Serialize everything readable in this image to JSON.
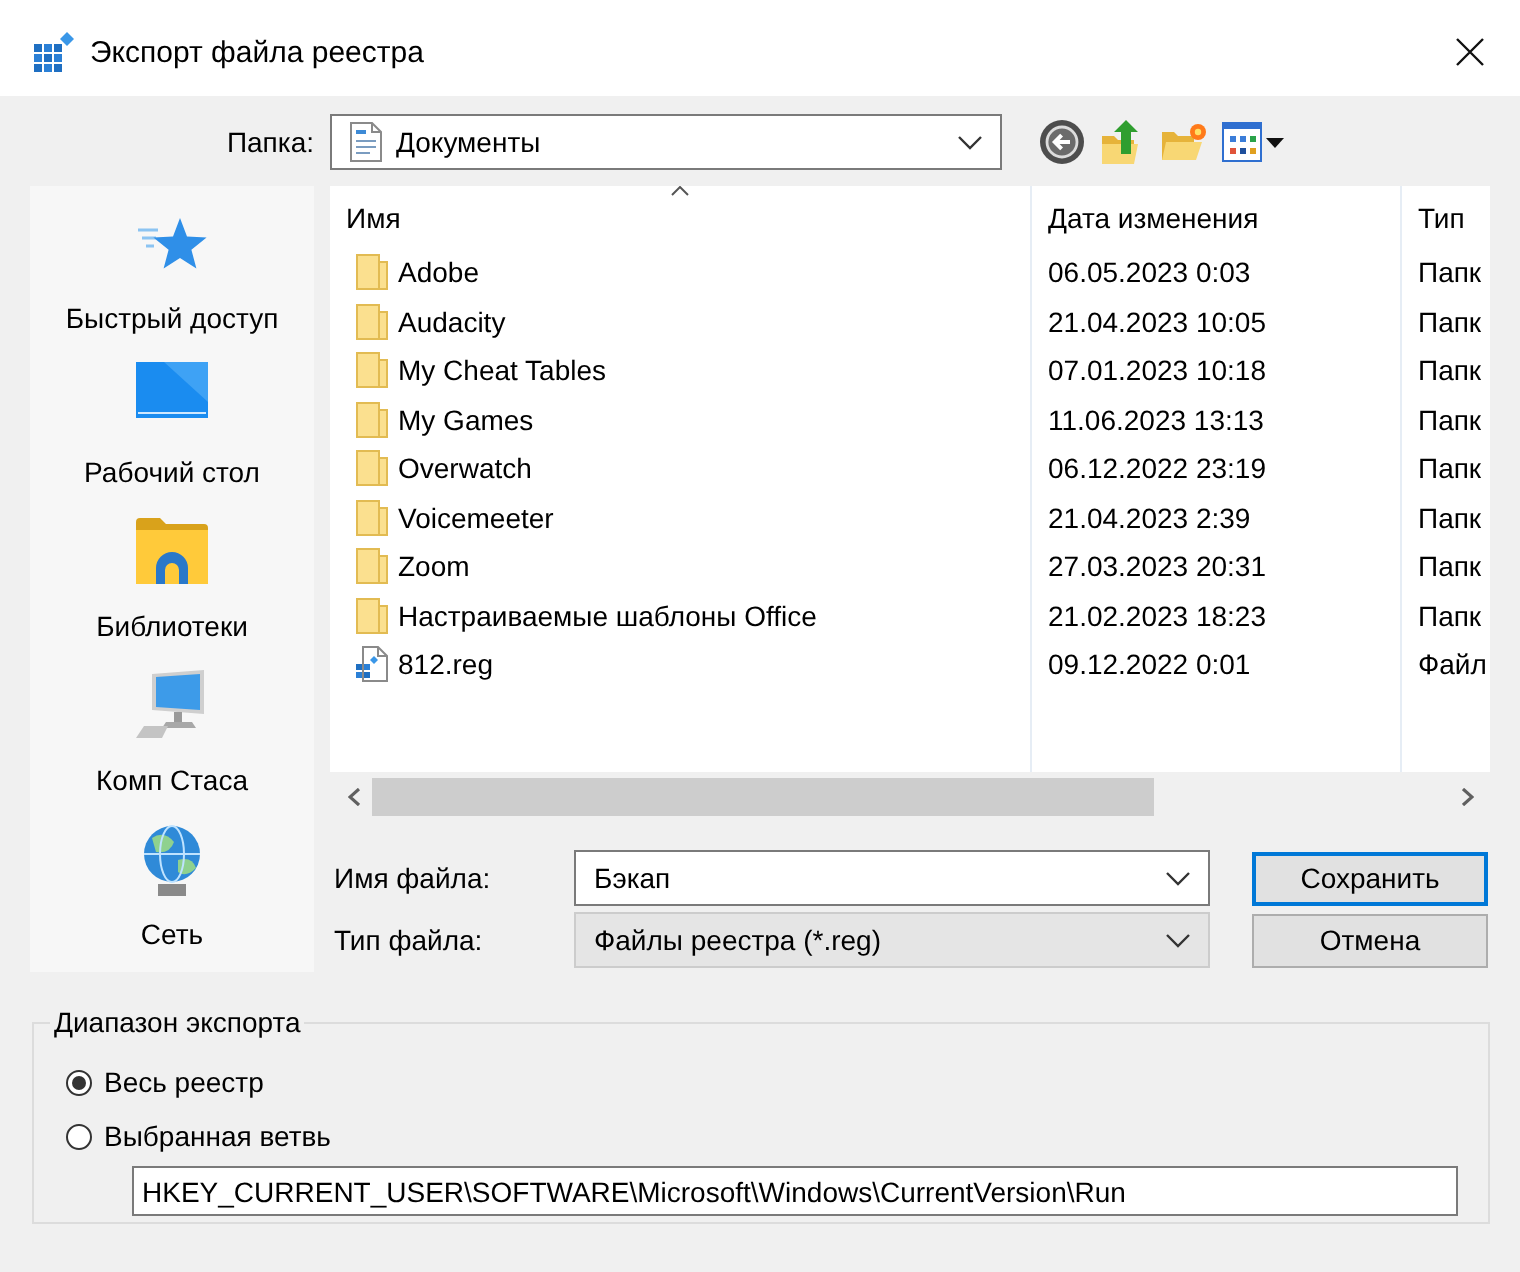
{
  "window": {
    "title": "Экспорт файла реестра"
  },
  "folder": {
    "label": "Папка:",
    "value": "Документы"
  },
  "places": [
    {
      "kind": "quick_access",
      "label": "Быстрый доступ"
    },
    {
      "kind": "desktop",
      "label": "Рабочий стол"
    },
    {
      "kind": "libraries",
      "label": "Библиотеки"
    },
    {
      "kind": "computer",
      "label": "Комп Стаса"
    },
    {
      "kind": "network",
      "label": "Сеть"
    }
  ],
  "file_list": {
    "columns": [
      {
        "label": "Имя",
        "sorted": true
      },
      {
        "label": "Дата изменения",
        "sorted": false
      },
      {
        "label": "Тип",
        "sorted": false
      }
    ],
    "rows": [
      {
        "kind": "folder",
        "name": "Adobe",
        "date": "06.05.2023 0:03",
        "type": "Папк"
      },
      {
        "kind": "folder",
        "name": "Audacity",
        "date": "21.04.2023 10:05",
        "type": "Папк"
      },
      {
        "kind": "folder",
        "name": "My Cheat Tables",
        "date": "07.01.2023 10:18",
        "type": "Папк"
      },
      {
        "kind": "folder",
        "name": "My Games",
        "date": "11.06.2023 13:13",
        "type": "Папк"
      },
      {
        "kind": "folder",
        "name": "Overwatch",
        "date": "06.12.2022 23:19",
        "type": "Папк"
      },
      {
        "kind": "folder",
        "name": "Voicemeeter",
        "date": "21.04.2023 2:39",
        "type": "Папк"
      },
      {
        "kind": "folder",
        "name": "Zoom",
        "date": "27.03.2023 20:31",
        "type": "Папк"
      },
      {
        "kind": "folder",
        "name": "Настраиваемые шаблоны Office",
        "date": "21.02.2023 18:23",
        "type": "Папк"
      },
      {
        "kind": "reg_file",
        "name": "812.reg",
        "date": "09.12.2022 0:01",
        "type": "Файл"
      }
    ]
  },
  "file_name": {
    "label": "Имя файла:",
    "value": "Бэкап"
  },
  "file_type": {
    "label": "Тип файла:",
    "value": "Файлы реестра (*.reg)"
  },
  "buttons": [
    {
      "label": "Сохранить",
      "default": true
    },
    {
      "label": "Отмена",
      "default": false
    }
  ],
  "export_range": {
    "title": "Диапазон экспорта",
    "options": [
      {
        "label": "Весь реестр",
        "selected": true
      },
      {
        "label": "Выбранная ветвь",
        "selected": false
      }
    ],
    "branch_path": {
      "value": "HKEY_CURRENT_USER\\SOFTWARE\\Microsoft\\Windows\\CurrentVersion\\Run"
    }
  }
}
